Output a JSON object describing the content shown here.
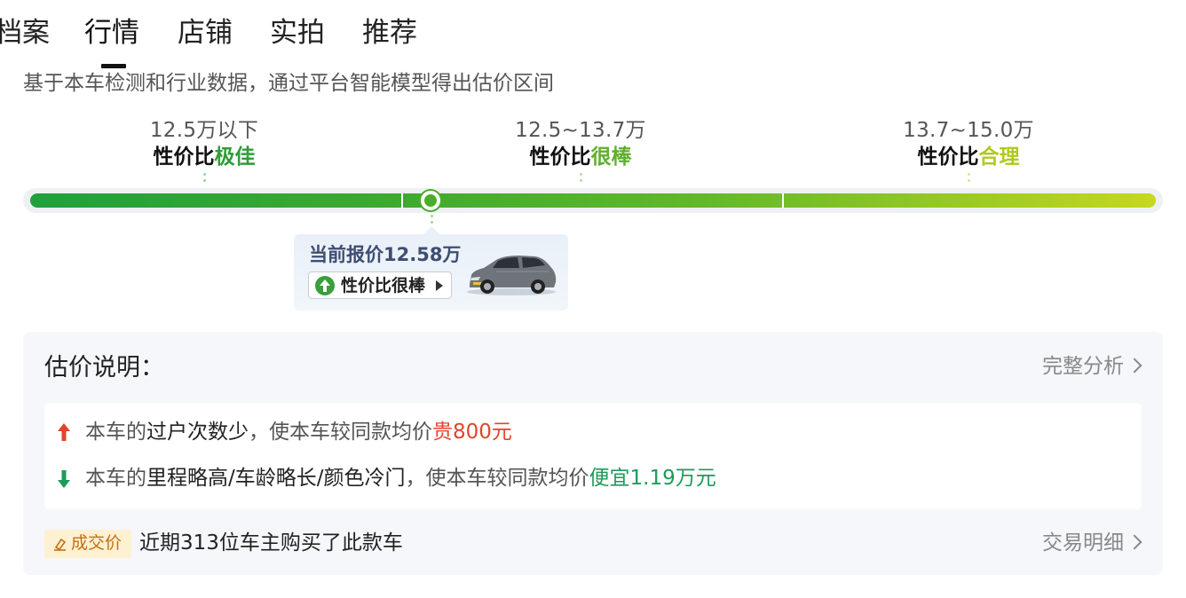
{
  "tabs": [
    {
      "label": "档案"
    },
    {
      "label": "行情"
    },
    {
      "label": "店铺"
    },
    {
      "label": "实拍"
    },
    {
      "label": "推荐"
    }
  ],
  "active_tab": "行情",
  "description": "基于本车检测和行业数据，通过平台智能模型得出估价区间",
  "segments": [
    {
      "price": "12.5万以下",
      "eval_prefix": "性价比",
      "eval_highlight": "极佳",
      "color": "#2e9d36"
    },
    {
      "price": "12.5~13.7万",
      "eval_prefix": "性价比",
      "eval_highlight": "很棒",
      "color": "#5fb02c"
    },
    {
      "price": "13.7~15.0万",
      "eval_prefix": "性价比",
      "eval_highlight": "合理",
      "color": "#b2c81e"
    }
  ],
  "current": {
    "price_label": "当前报价12.58万",
    "badge": "性价比很棒"
  },
  "explanation": {
    "title": "估价说明：",
    "full_analysis_link": "完整分析",
    "reasons": [
      {
        "direction": "up",
        "prefix": "本车的",
        "factor": "过户次数少",
        "middle": "，使本车较同款均价",
        "effect": "贵800元"
      },
      {
        "direction": "down",
        "prefix": "本车的",
        "factor": "里程略高/车龄略长/颜色冷门",
        "middle": "，使本车较同款均价",
        "effect": "便宜1.19万元"
      }
    ]
  },
  "footer": {
    "tag": "成交价",
    "text": "近期313位车主购买了此款车",
    "link": "交易明细"
  },
  "colors": {
    "accent_green": "#4aae2c",
    "price_up_red": "#e0452c",
    "price_down_green": "#1e9a5a",
    "deal_tag_orange": "#c46f10"
  },
  "icons": {
    "up": "arrow-up-icon",
    "down": "arrow-down-icon",
    "badge": "circle-up-arrow-icon",
    "deal": "price-tag-icon",
    "link": "chevron-right-icon"
  }
}
